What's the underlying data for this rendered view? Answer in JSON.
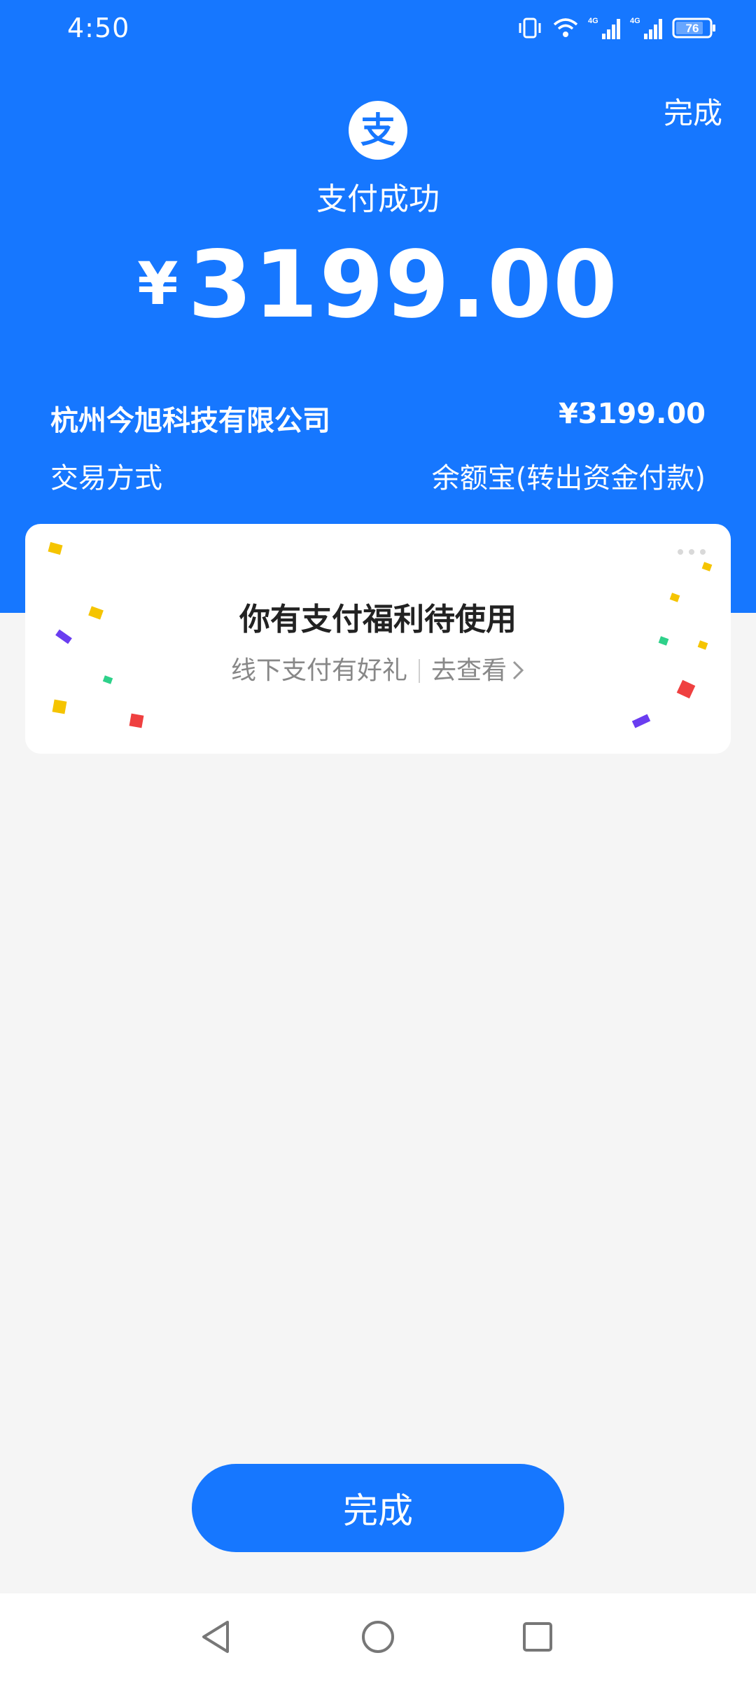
{
  "status_bar": {
    "time": "4:50",
    "battery": "76",
    "network_1": "4G",
    "network_2": "4G"
  },
  "header": {
    "done_label": "完成",
    "logo_char": "支",
    "title": "支付成功",
    "currency": "¥",
    "amount": "3199.00"
  },
  "details": {
    "merchant": "杭州今旭科技有限公司",
    "merchant_amount": "¥3199.00",
    "method_label": "交易方式",
    "method_value": "余额宝(转出资金付款)"
  },
  "benefit": {
    "title": "你有支付福利待使用",
    "subtitle": "线下支付有好礼",
    "link": "去查看"
  },
  "footer": {
    "done_button_label": "完成"
  },
  "colors": {
    "brand_blue": "#1677ff",
    "background": "#f5f5f5"
  },
  "icons": [
    "vibrate-icon",
    "wifi-icon",
    "signal-icon",
    "battery-icon",
    "alipay-logo",
    "chevron-right-icon",
    "back-triangle-icon",
    "home-circle-icon",
    "recents-square-icon"
  ]
}
